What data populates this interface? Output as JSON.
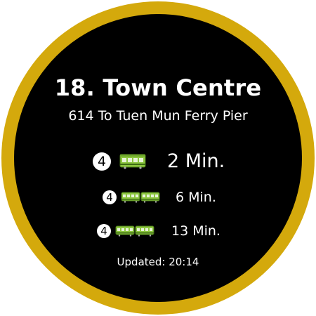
{
  "stop": {
    "title": "18. Town Centre",
    "route_destination": "614 To Tuen Mun Ferry Pier"
  },
  "arrivals": [
    {
      "route": "4",
      "vehicle_icon": "light-rail-single-car-icon",
      "time": "2 Min."
    },
    {
      "route": "4",
      "vehicle_icon": "light-rail-two-car-icon",
      "time": "6 Min."
    },
    {
      "route": "4",
      "vehicle_icon": "light-rail-two-car-icon",
      "time": "13 Min."
    }
  ],
  "status": {
    "updated": "Updated: 20:14"
  },
  "colors": {
    "bezel": "#d4a90c",
    "face": "#000000",
    "train_body": "#8cc63f",
    "text": "#ffffff"
  }
}
